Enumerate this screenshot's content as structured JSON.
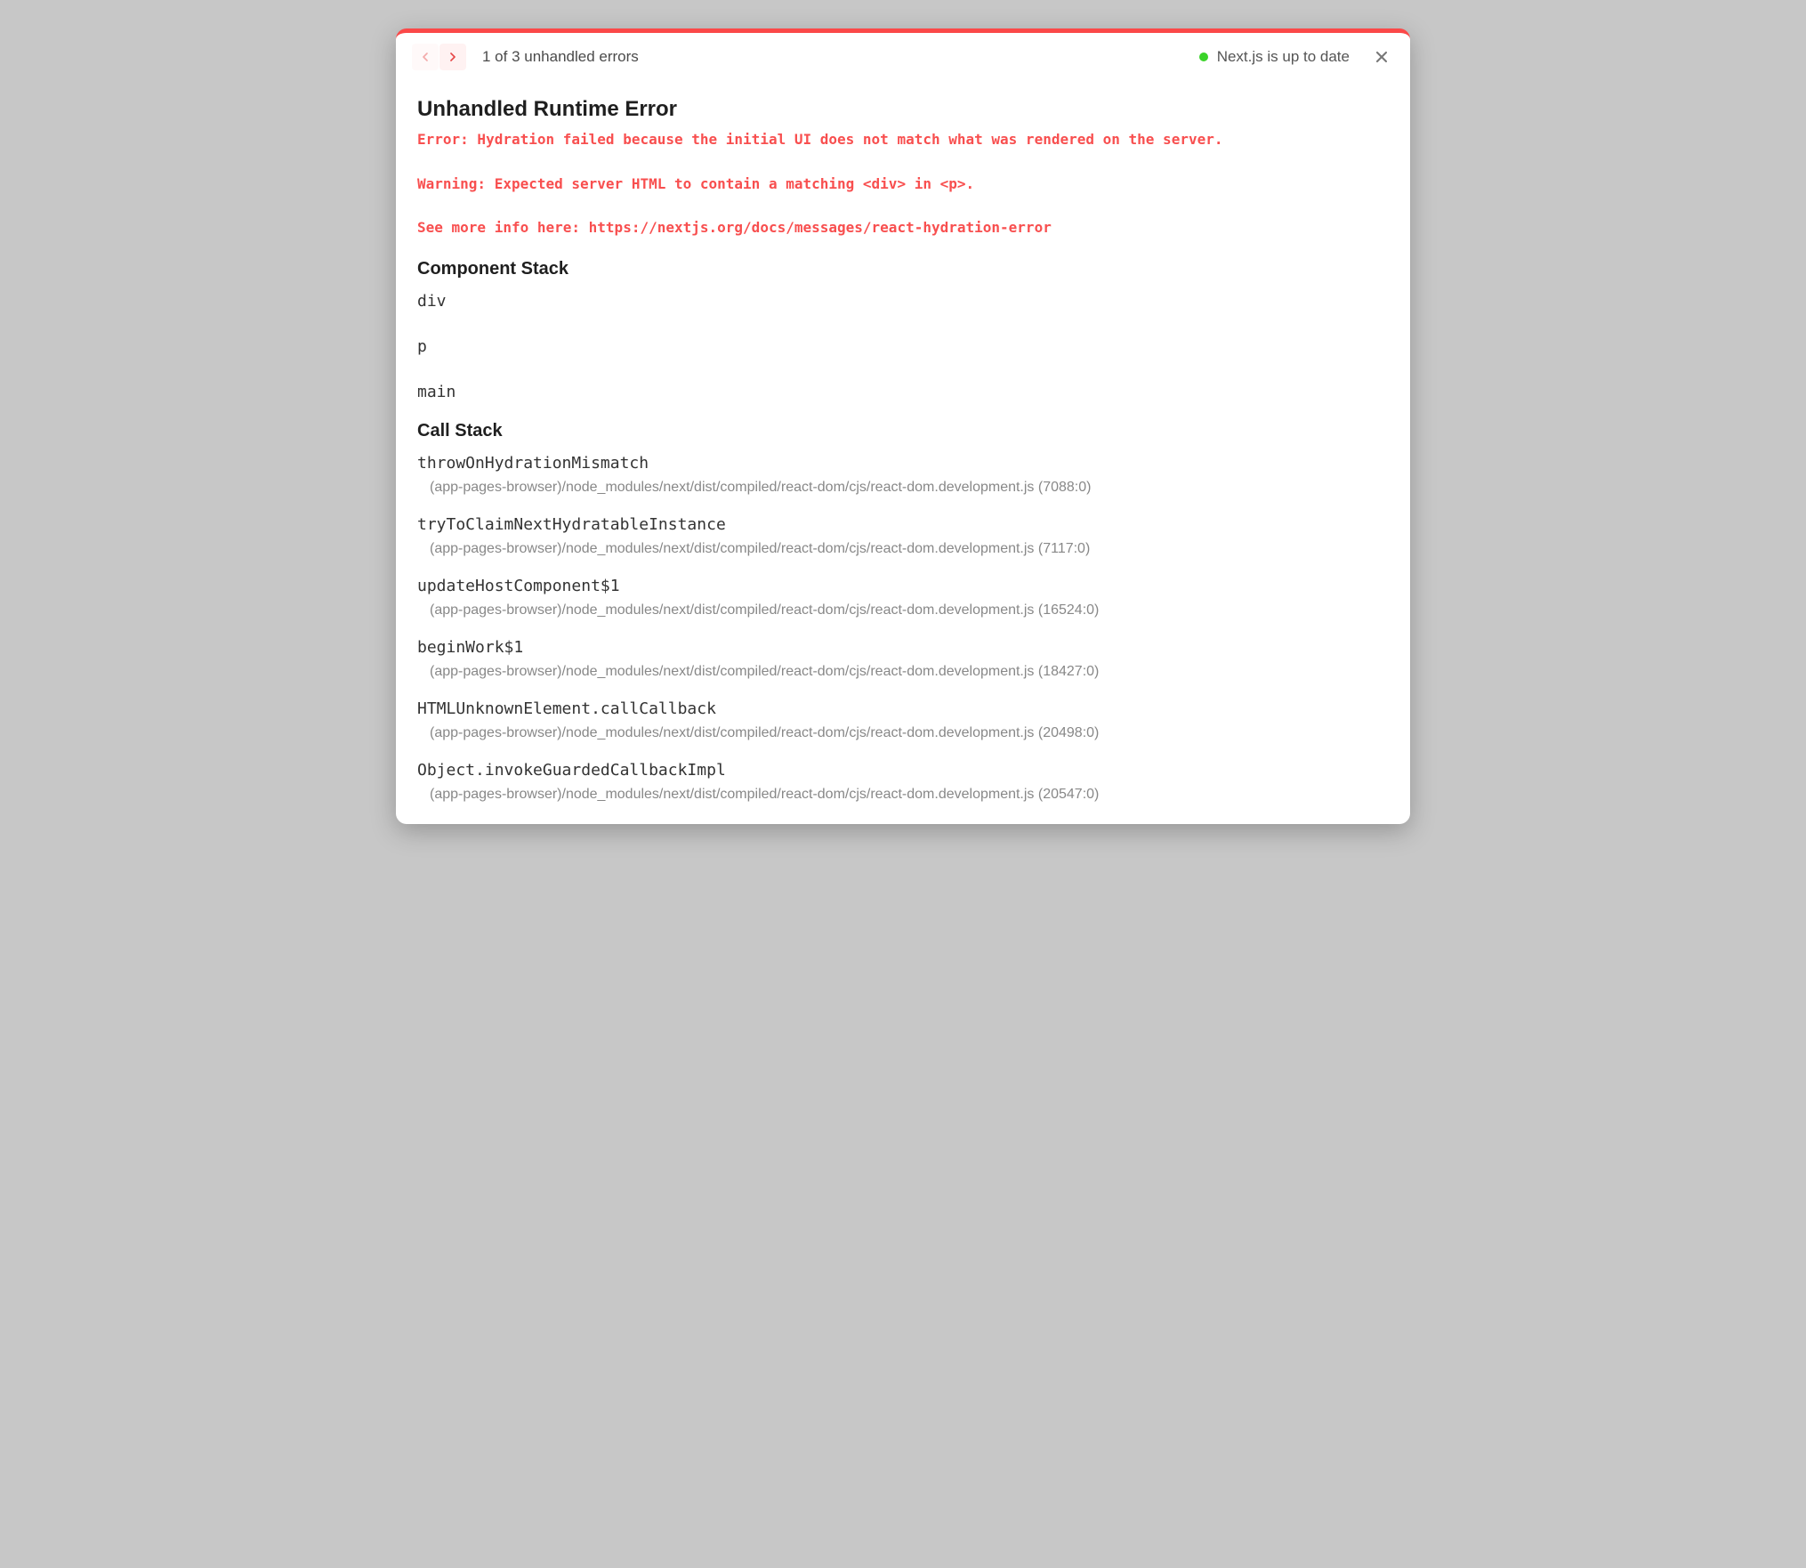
{
  "colors": {
    "accent": "#fb4848",
    "status_green": "#3ad329"
  },
  "header": {
    "pagination_text": "1 of 3 unhandled errors",
    "status_text": "Next.js is up to date",
    "icons": {
      "prev": "arrow-left-icon",
      "next": "arrow-right-icon",
      "close": "close-icon"
    }
  },
  "dialog": {
    "title": "Unhandled Runtime Error",
    "error_line": "Error: Hydration failed because the initial UI does not match what was rendered on the server.",
    "warning_line": "Warning: Expected server HTML to contain a matching <div> in <p>.",
    "info_line": "See more info here: https://nextjs.org/docs/messages/react-hydration-error"
  },
  "component_stack": {
    "heading": "Component Stack",
    "items": [
      "div",
      "p",
      "main"
    ]
  },
  "call_stack": {
    "heading": "Call Stack",
    "frames": [
      {
        "fn": "throwOnHydrationMismatch",
        "loc": "(app-pages-browser)/node_modules/next/dist/compiled/react-dom/cjs/react-dom.development.js (7088:0)"
      },
      {
        "fn": "tryToClaimNextHydratableInstance",
        "loc": "(app-pages-browser)/node_modules/next/dist/compiled/react-dom/cjs/react-dom.development.js (7117:0)"
      },
      {
        "fn": "updateHostComponent$1",
        "loc": "(app-pages-browser)/node_modules/next/dist/compiled/react-dom/cjs/react-dom.development.js (16524:0)"
      },
      {
        "fn": "beginWork$1",
        "loc": "(app-pages-browser)/node_modules/next/dist/compiled/react-dom/cjs/react-dom.development.js (18427:0)"
      },
      {
        "fn": "HTMLUnknownElement.callCallback",
        "loc": "(app-pages-browser)/node_modules/next/dist/compiled/react-dom/cjs/react-dom.development.js (20498:0)"
      },
      {
        "fn": "Object.invokeGuardedCallbackImpl",
        "loc": "(app-pages-browser)/node_modules/next/dist/compiled/react-dom/cjs/react-dom.development.js (20547:0)"
      }
    ]
  }
}
